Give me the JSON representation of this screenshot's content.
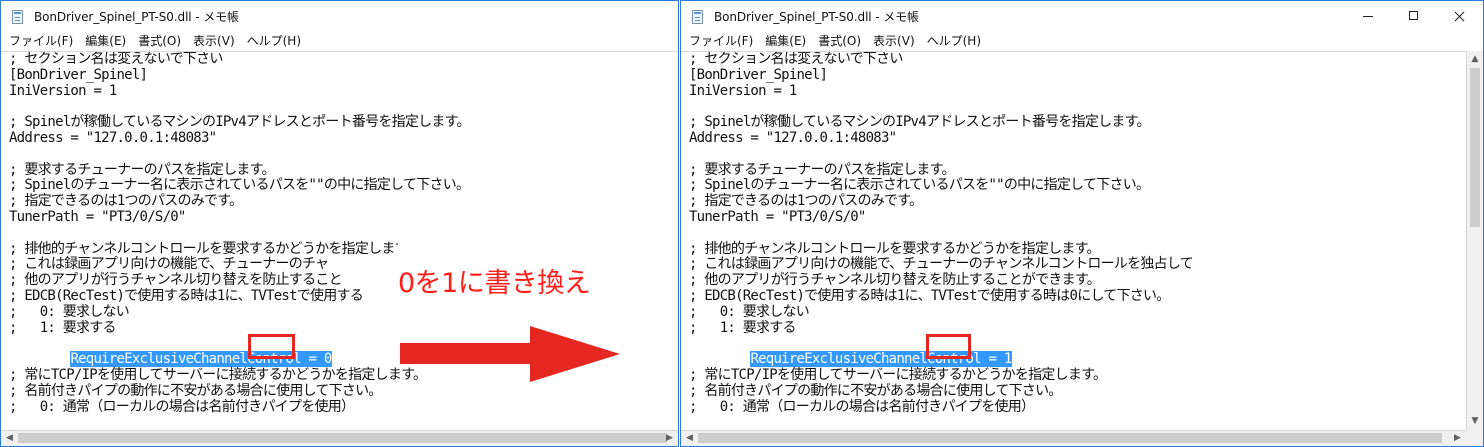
{
  "screens": {
    "left": {
      "title": "BonDriver_Spinel_PT-S0.dll - メモ帳",
      "selected_line_visible": "RequireExclusiveChannelControl = 0"
    },
    "right": {
      "title": "BonDriver_Spinel_PT-S0.dll - メモ帳",
      "selected_line_visible": "RequireExclusiveChannelControl = 1"
    }
  },
  "menu": {
    "file": "ファイル(F)",
    "edit": "編集(E)",
    "format": "書式(O)",
    "view": "表示(V)",
    "help": "ヘルプ(H)"
  },
  "left_editor": {
    "line_01": "; セクション名は変えないで下さい",
    "line_02": "[BonDriver_Spinel]",
    "line_03": "IniVersion = 1",
    "line_04": "",
    "line_05": "; Spinelが稼働しているマシンのIPv4アドレスとポート番号を指定します。",
    "line_06": "Address = \"127.0.0.1:48083\"",
    "line_07": "",
    "line_08": "; 要求するチューナーのパスを指定します。",
    "line_09": "; Spinelのチューナー名に表示されているパスを\"\"の中に指定して下さい。",
    "line_10": "; 指定できるのは1つのパスのみです。",
    "line_11": "TunerPath = \"PT3/0/S/0\"",
    "line_12": "",
    "line_13": "; 排他的チャンネルコントロールを要求するかどうかを指定します",
    "line_14": "; これは録画アプリ向けの機能で、チューナーのチャ",
    "line_15": "; 他のアプリが行うチャンネル切り替えを防止すること",
    "line_16": "; EDCB(RecTest)で使用する時は1に、TVTestで使用する",
    "line_17": ";   0: 要求しない",
    "line_18": ";   1: 要求する",
    "line_19_selected": "RequireExclusiveChannelControl = 0",
    "line_20": "",
    "line_21": "; 常にTCP/IPを使用してサーバーに接続するかどうかを指定します。",
    "line_22": "; 名前付きパイプの動作に不安がある場合に使用して下さい。",
    "line_23": ";   0: 通常（ローカルの場合は名前付きパイプを使用）"
  },
  "right_editor": {
    "line_01": "; セクション名は変えないで下さい",
    "line_02": "[BonDriver_Spinel]",
    "line_03": "IniVersion = 1",
    "line_04": "",
    "line_05": "; Spinelが稼働しているマシンのIPv4アドレスとポート番号を指定します。",
    "line_06": "Address = \"127.0.0.1:48083\"",
    "line_07": "",
    "line_08": "; 要求するチューナーのパスを指定します。",
    "line_09": "; Spinelのチューナー名に表示されているパスを\"\"の中に指定して下さい。",
    "line_10": "; 指定できるのは1つのパスのみです。",
    "line_11": "TunerPath = \"PT3/0/S/0\"",
    "line_12": "",
    "line_13": "; 排他的チャンネルコントロールを要求するかどうかを指定します。",
    "line_14": "; これは録画アプリ向けの機能で、チューナーのチャンネルコントロールを独占して",
    "line_15": "; 他のアプリが行うチャンネル切り替えを防止することができます。",
    "line_16": "; EDCB(RecTest)で使用する時は1に、TVTestで使用する時は0にして下さい。",
    "line_17": ";   0: 要求しない",
    "line_18": ";   1: 要求する",
    "line_19_selected": "RequireExclusiveChannelControl = 1",
    "line_20": "",
    "line_21": "; 常にTCP/IPを使用してサーバーに接続するかどうかを指定します。",
    "line_22": "; 名前付きパイプの動作に不安がある場合に使用して下さい。",
    "line_23": ";   0: 通常（ローカルの場合は名前付きパイプを使用）"
  },
  "annotation": {
    "text": "0を1に書き換え",
    "accent": "#ff1f1a"
  },
  "colors": {
    "selection": "#3399ff",
    "window_border": "#2b7bd8",
    "highlight_box": "#e52621"
  },
  "icons": {
    "app": "notepad-icon",
    "minimize": "minimize-icon",
    "maximize": "maximize-icon",
    "close": "close-icon",
    "arrow": "right-arrow-icon"
  }
}
